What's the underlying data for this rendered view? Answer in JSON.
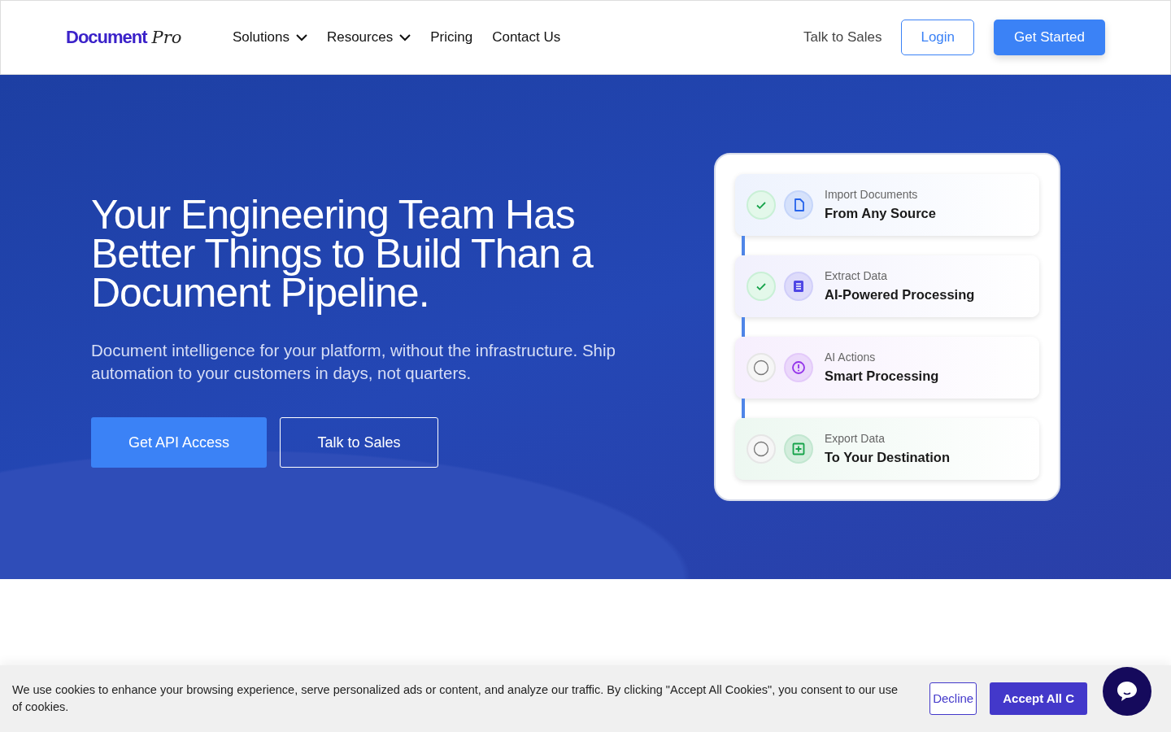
{
  "header": {
    "logo": {
      "word": "Document",
      "script": "Pro"
    },
    "nav": [
      {
        "label": "Solutions",
        "dropdown": true
      },
      {
        "label": "Resources",
        "dropdown": true
      },
      {
        "label": "Pricing",
        "dropdown": false
      },
      {
        "label": "Contact Us",
        "dropdown": false
      }
    ],
    "talk_link": "Talk to Sales",
    "login": "Login",
    "get_started": "Get Started"
  },
  "hero": {
    "title": "Your Engineering Team Has Better Things to Build Than a Document Pipeline.",
    "subtitle": "Document intelligence for your platform, without the infrastructure. Ship automation to your customers in days, not quarters.",
    "primary_button": "Get API Access",
    "secondary_button": "Talk to Sales"
  },
  "pipeline": [
    {
      "label": "Import Documents",
      "title": "From Any Source",
      "done": true,
      "kind": "document",
      "color": "#2563eb"
    },
    {
      "label": "Extract Data",
      "title": "AI-Powered Processing",
      "done": true,
      "kind": "list",
      "color": "#4f46e5"
    },
    {
      "label": "AI Actions",
      "title": "Smart Processing",
      "done": false,
      "kind": "alert",
      "color": "#9333ea"
    },
    {
      "label": "Export Data",
      "title": "To Your Destination",
      "done": false,
      "kind": "plus",
      "color": "#16a34a"
    }
  ],
  "cookie_banner": {
    "text": "We use cookies to enhance your browsing experience, serve personalized ads or content, and analyze our traffic. By clicking \"Accept All Cookies\", you consent to our use of cookies.",
    "decline": "Decline",
    "accept": "Accept All C"
  }
}
